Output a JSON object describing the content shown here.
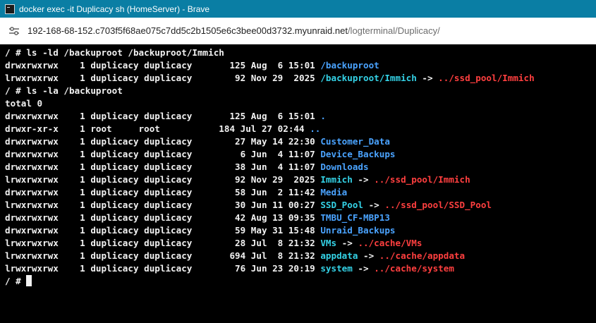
{
  "window": {
    "title": "docker exec -it Duplicacy sh (HomeServer) - Brave"
  },
  "address_bar": {
    "host": "192-168-68-152.c703f5f68ae075c7dd5c2b1505e6c3bee00d3732.myunraid.net",
    "path": "/logterminal/Duplicacy/"
  },
  "terminal": {
    "lines": [
      {
        "kind": "cmd",
        "text": "/ # ls -ld /backuproot /backuproot/Immich"
      },
      {
        "kind": "entry",
        "prefix": "drwxrwxrwx    1 duplicacy duplicacy       125 Aug  6 15:01 ",
        "name": "/backuproot",
        "name_class": "dir"
      },
      {
        "kind": "entry",
        "prefix": "lrwxrwxrwx    1 duplicacy duplicacy        92 Nov 29  2025 ",
        "name": "/backuproot/Immich",
        "name_class": "link",
        "target": "../ssd_pool/Immich"
      },
      {
        "kind": "cmd",
        "text": "/ # ls -la /backuproot"
      },
      {
        "kind": "cmd",
        "text": "total 0"
      },
      {
        "kind": "entry",
        "prefix": "drwxrwxrwx    1 duplicacy duplicacy       125 Aug  6 15:01 ",
        "name": ".",
        "name_class": "dir"
      },
      {
        "kind": "entry",
        "prefix": "drwxr-xr-x    1 root     root           184 Jul 27 02:44 ",
        "name": "..",
        "name_class": "dir"
      },
      {
        "kind": "entry",
        "prefix": "drwxrwxrwx    1 duplicacy duplicacy        27 May 14 22:30 ",
        "name": "Customer_Data",
        "name_class": "dir"
      },
      {
        "kind": "entry",
        "prefix": "drwxrwxrwx    1 duplicacy duplicacy         6 Jun  4 11:07 ",
        "name": "Device_Backups",
        "name_class": "dir"
      },
      {
        "kind": "entry",
        "prefix": "drwxrwxrwx    1 duplicacy duplicacy        38 Jun  4 11:07 ",
        "name": "Downloads",
        "name_class": "dir"
      },
      {
        "kind": "entry",
        "prefix": "lrwxrwxrwx    1 duplicacy duplicacy        92 Nov 29  2025 ",
        "name": "Immich",
        "name_class": "link",
        "target": "../ssd_pool/Immich"
      },
      {
        "kind": "entry",
        "prefix": "drwxrwxrwx    1 duplicacy duplicacy        58 Jun  2 11:42 ",
        "name": "Media",
        "name_class": "dir"
      },
      {
        "kind": "entry",
        "prefix": "lrwxrwxrwx    1 duplicacy duplicacy        30 Jun 11 00:27 ",
        "name": "SSD_Pool",
        "name_class": "link",
        "target": "../ssd_pool/SSD_Pool"
      },
      {
        "kind": "entry",
        "prefix": "drwxrwxrwx    1 duplicacy duplicacy        42 Aug 13 09:35 ",
        "name": "TMBU_CF-MBP13",
        "name_class": "dir"
      },
      {
        "kind": "entry",
        "prefix": "drwxrwxrwx    1 duplicacy duplicacy        59 May 31 15:48 ",
        "name": "Unraid_Backups",
        "name_class": "dir"
      },
      {
        "kind": "entry",
        "prefix": "lrwxrwxrwx    1 duplicacy duplicacy        28 Jul  8 21:32 ",
        "name": "VMs",
        "name_class": "link",
        "target": "../cache/VMs"
      },
      {
        "kind": "entry",
        "prefix": "lrwxrwxrwx    1 duplicacy duplicacy       694 Jul  8 21:32 ",
        "name": "appdata",
        "name_class": "link",
        "target": "../cache/appdata"
      },
      {
        "kind": "entry",
        "prefix": "lrwxrwxrwx    1 duplicacy duplicacy        76 Jun 23 20:19 ",
        "name": "system",
        "name_class": "link",
        "target": "../cache/system"
      },
      {
        "kind": "prompt",
        "text": "/ # "
      }
    ],
    "arrow": " -> "
  }
}
